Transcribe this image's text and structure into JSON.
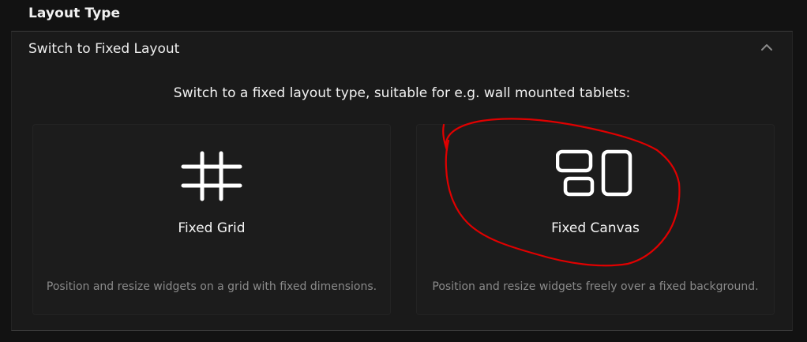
{
  "section": {
    "title": "Layout Type"
  },
  "panel": {
    "title": "Switch to Fixed Layout",
    "collapse_icon": "chevron-up-icon",
    "intro": "Switch to a fixed layout type, suitable for e.g. wall mounted tablets:",
    "options": [
      {
        "icon": "grid-icon",
        "title": "Fixed Grid",
        "description": "Position and resize widgets on a grid with fixed dimensions."
      },
      {
        "icon": "canvas-icon",
        "title": "Fixed Canvas",
        "description": "Position and resize widgets freely over a fixed background."
      }
    ]
  },
  "colors": {
    "background": "#121212",
    "panel": "#1a1a1a",
    "card": "#1c1c1c",
    "description": "#8a8a8a",
    "annotation": "#e00000"
  }
}
